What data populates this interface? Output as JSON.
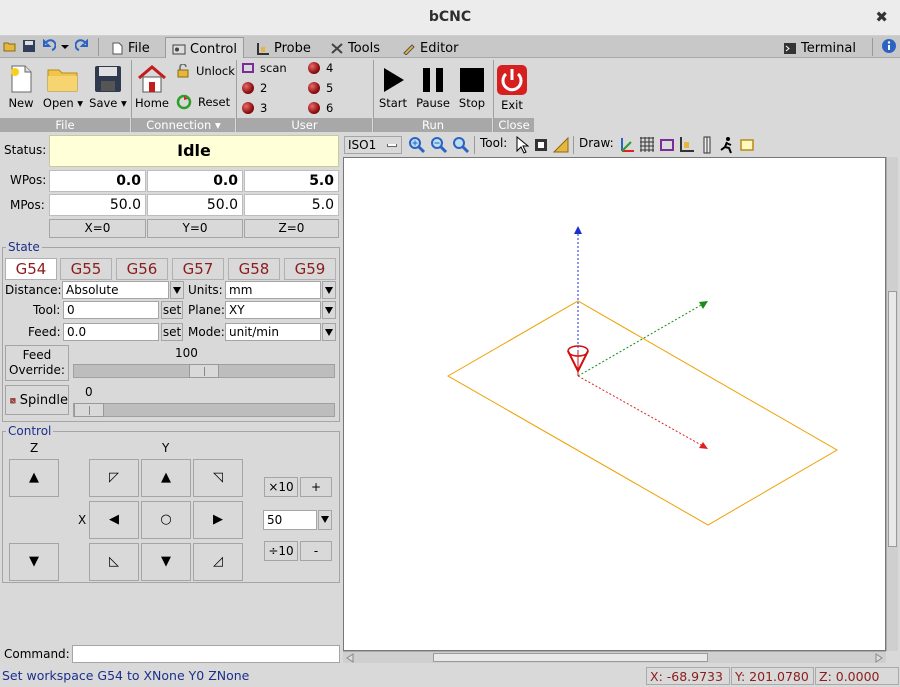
{
  "window": {
    "title": "bCNC",
    "close_glyph": "✖"
  },
  "tabs": [
    {
      "label": "File",
      "icon": "file-icon"
    },
    {
      "label": "Control",
      "icon": "control-icon",
      "active": true
    },
    {
      "label": "Probe",
      "icon": "probe-icon"
    },
    {
      "label": "Tools",
      "icon": "tools-icon"
    },
    {
      "label": "Editor",
      "icon": "editor-icon"
    }
  ],
  "terminal_tab": "Terminal",
  "ribbon": {
    "file": {
      "new": "New",
      "open": "Open",
      "save": "Save",
      "group": "File"
    },
    "connection": {
      "home": "Home",
      "unlock": "Unlock",
      "reset": "Reset",
      "group": "Connection"
    },
    "user": {
      "scan": "scan",
      "b2": "2",
      "b3": "3",
      "b4": "4",
      "b5": "5",
      "b6": "6",
      "group": "User"
    },
    "run": {
      "start": "Start",
      "pause": "Pause",
      "stop": "Stop",
      "group": "Run"
    },
    "close": {
      "exit": "Exit",
      "group": "Close"
    }
  },
  "status": {
    "label": "Status:",
    "value": "Idle",
    "bg": "#ffffd8"
  },
  "wpos": {
    "label": "WPos:",
    "x": "0.0",
    "y": "0.0",
    "z": "5.0"
  },
  "mpos": {
    "label": "MPos:",
    "x": "50.0",
    "y": "50.0",
    "z": "5.0"
  },
  "zero": {
    "x": "X=0",
    "y": "Y=0",
    "z": "Z=0"
  },
  "state": {
    "legend": "State",
    "wcs": [
      "G54",
      "G55",
      "G56",
      "G57",
      "G58",
      "G59"
    ],
    "distance": {
      "label": "Distance:",
      "value": "Absolute"
    },
    "units": {
      "label": "Units:",
      "value": "mm"
    },
    "tool": {
      "label": "Tool:",
      "value": "0",
      "set": "set"
    },
    "plane": {
      "label": "Plane:",
      "value": "XY"
    },
    "feed": {
      "label": "Feed:",
      "value": "0.0",
      "set": "set"
    },
    "mode": {
      "label": "Mode:",
      "value": "unit/min"
    },
    "feed_override": {
      "label_line1": "Feed",
      "label_line2": "Override:",
      "value": "100",
      "fraction": 0.5
    },
    "spindle": {
      "label": "Spindle",
      "value": "0",
      "fraction": 0.0
    }
  },
  "control": {
    "legend": "Control",
    "z_label": "Z",
    "y_label": "Y",
    "x_label": "X",
    "up": "▲",
    "down": "▼",
    "left": "◀",
    "right": "▶",
    "center": "○",
    "ul": "◸",
    "ur": "◹",
    "dl": "◺",
    "dr": "◿",
    "x10": "×10",
    "plus": "+",
    "step": "50",
    "div10": "÷10",
    "minus": "-"
  },
  "command": {
    "label": "Command:",
    "value": ""
  },
  "viewer": {
    "view": "ISO1",
    "tool_label": "Tool:",
    "draw_label": "Draw:"
  },
  "statusbar": {
    "message": "Set workspace G54 to XNone Y0 ZNone",
    "x": "X: -68.9733",
    "y": "Y: 201.0780",
    "z": "Z: 0.0000"
  },
  "colors": {
    "accent_blue": "#1c2f8c",
    "wcs_red": "#8a1d1d",
    "path_orange": "#f0a000"
  }
}
